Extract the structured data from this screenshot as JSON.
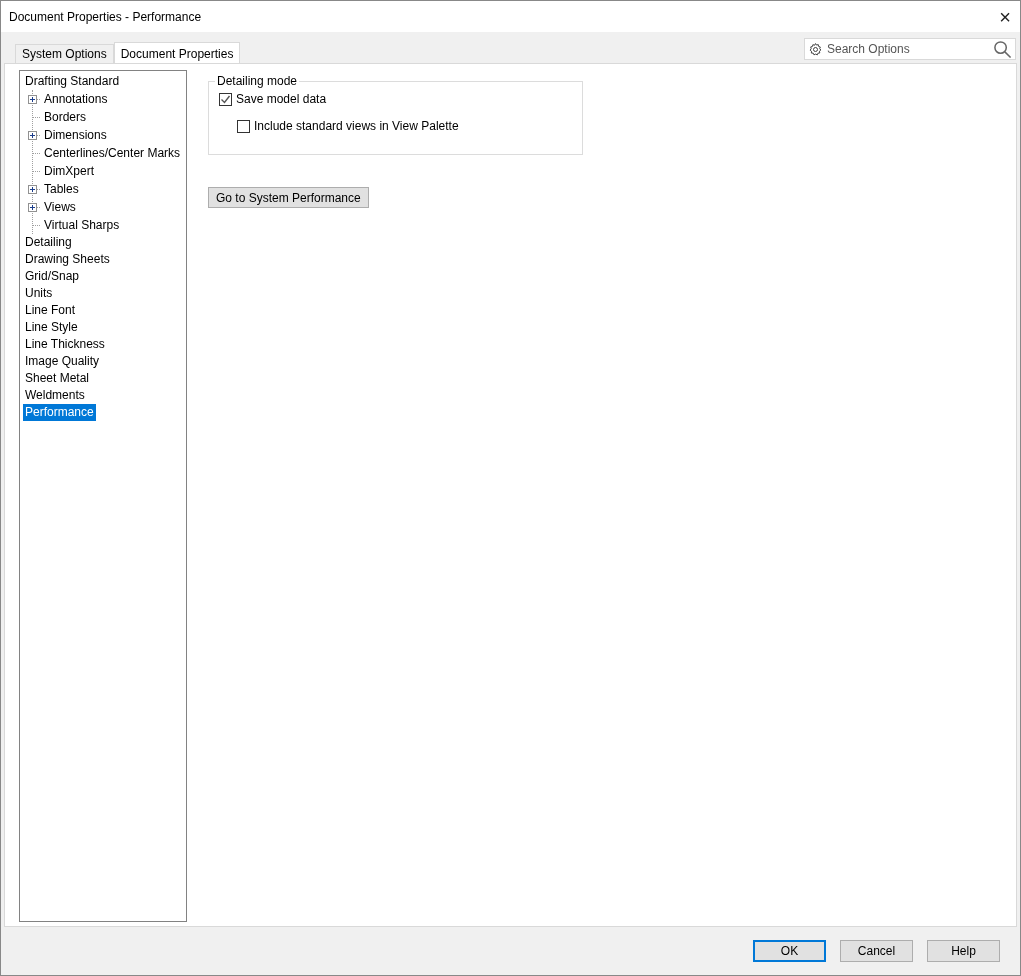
{
  "window": {
    "title": "Document Properties - Performance",
    "close": "×"
  },
  "tabs": [
    {
      "label": "System Options",
      "selected": false
    },
    {
      "label": "Document Properties",
      "selected": true
    }
  ],
  "search": {
    "placeholder": "Search Options"
  },
  "tree": [
    {
      "label": "Drafting Standard",
      "selected": false,
      "children": [
        {
          "label": "Annotations",
          "expandable": true,
          "expanded": false,
          "selected": false
        },
        {
          "label": "Borders",
          "expandable": false,
          "selected": false
        },
        {
          "label": "Dimensions",
          "expandable": true,
          "expanded": false,
          "selected": false
        },
        {
          "label": "Centerlines/Center Marks",
          "expandable": false,
          "selected": false
        },
        {
          "label": "DimXpert",
          "expandable": false,
          "selected": false
        },
        {
          "label": "Tables",
          "expandable": true,
          "expanded": false,
          "selected": false
        },
        {
          "label": "Views",
          "expandable": true,
          "expanded": false,
          "selected": false
        },
        {
          "label": "Virtual Sharps",
          "expandable": false,
          "selected": false
        }
      ]
    },
    {
      "label": "Detailing",
      "selected": false
    },
    {
      "label": "Drawing Sheets",
      "selected": false
    },
    {
      "label": "Grid/Snap",
      "selected": false
    },
    {
      "label": "Units",
      "selected": false
    },
    {
      "label": "Line Font",
      "selected": false
    },
    {
      "label": "Line Style",
      "selected": false
    },
    {
      "label": "Line Thickness",
      "selected": false
    },
    {
      "label": "Image Quality",
      "selected": false
    },
    {
      "label": "Sheet Metal",
      "selected": false
    },
    {
      "label": "Weldments",
      "selected": false
    },
    {
      "label": "Performance",
      "selected": true
    }
  ],
  "group": {
    "title": "Detailing mode",
    "options": [
      {
        "label": "Save model data",
        "checked": true,
        "indented": false
      },
      {
        "label": "Include standard views in View Palette",
        "checked": false,
        "indented": true
      }
    ]
  },
  "action_button": "Go to System Performance",
  "buttons": [
    {
      "label": "OK",
      "default": true
    },
    {
      "label": "Cancel",
      "default": false
    },
    {
      "label": "Help",
      "default": false
    }
  ]
}
